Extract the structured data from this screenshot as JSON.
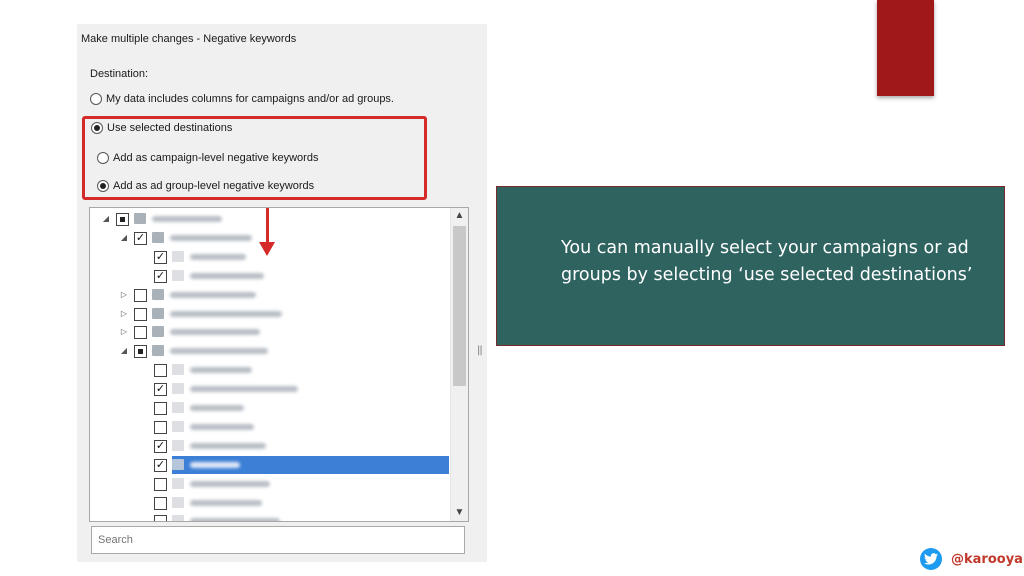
{
  "dialog": {
    "title": "Make multiple changes - Negative keywords",
    "destination_label": "Destination:",
    "options": [
      {
        "label": "My data includes columns for campaigns and/or ad groups.",
        "selected": false
      },
      {
        "label": "Use selected destinations",
        "selected": true
      },
      {
        "label": "Add as campaign-level negative keywords",
        "selected": false
      },
      {
        "label": "Add as ad group-level negative keywords",
        "selected": true
      }
    ],
    "tree_rows": [
      {
        "level": 0,
        "expander": "expanded",
        "check": "partial",
        "icon": "account-icon",
        "selected": false
      },
      {
        "level": 1,
        "expander": "expanded",
        "check": "checked",
        "icon": "campaign-icon",
        "selected": false
      },
      {
        "level": 2,
        "expander": "none",
        "check": "checked",
        "icon": "adgroup-icon",
        "selected": false
      },
      {
        "level": 2,
        "expander": "none",
        "check": "checked",
        "icon": "adgroup-icon",
        "selected": false
      },
      {
        "level": 1,
        "expander": "collapsed",
        "check": "unchecked",
        "icon": "campaign-icon",
        "selected": false
      },
      {
        "level": 1,
        "expander": "collapsed",
        "check": "unchecked",
        "icon": "display-campaign-icon",
        "selected": false
      },
      {
        "level": 1,
        "expander": "collapsed",
        "check": "unchecked",
        "icon": "display-campaign-icon",
        "selected": false
      },
      {
        "level": 1,
        "expander": "expanded",
        "check": "partial",
        "icon": "campaign-icon",
        "selected": false
      },
      {
        "level": 2,
        "expander": "none",
        "check": "unchecked",
        "icon": "adgroup-icon",
        "selected": false
      },
      {
        "level": 2,
        "expander": "none",
        "check": "checked",
        "icon": "adgroup-icon",
        "selected": false
      },
      {
        "level": 2,
        "expander": "none",
        "check": "unchecked",
        "icon": "adgroup-icon",
        "selected": false
      },
      {
        "level": 2,
        "expander": "none",
        "check": "unchecked",
        "icon": "adgroup-icon",
        "selected": false
      },
      {
        "level": 2,
        "expander": "none",
        "check": "checked",
        "icon": "adgroup-icon",
        "selected": false
      },
      {
        "level": 2,
        "expander": "none",
        "check": "checked",
        "icon": "adgroup-icon",
        "selected": true
      },
      {
        "level": 2,
        "expander": "none",
        "check": "unchecked",
        "icon": "adgroup-icon",
        "selected": false
      },
      {
        "level": 2,
        "expander": "none",
        "check": "unchecked",
        "icon": "adgroup-icon",
        "selected": false
      },
      {
        "level": 2,
        "expander": "none",
        "check": "unchecked",
        "icon": "adgroup-icon",
        "selected": false
      }
    ],
    "search_placeholder": "Search"
  },
  "callout": {
    "text": "You can manually select your campaigns or ad groups by selecting ‘use selected destinations’"
  },
  "footer": {
    "handle": "@karooya",
    "icon": "twitter-icon"
  },
  "colors": {
    "accent_red": "#a01818",
    "callout_bg": "#2e6360",
    "highlight_red": "#d42a2a",
    "selection_blue": "#3b7fd6"
  }
}
